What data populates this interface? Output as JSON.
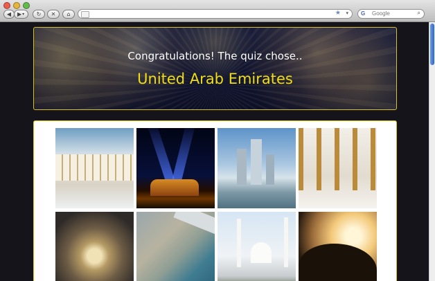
{
  "browser": {
    "url": "",
    "search_placeholder": "Google"
  },
  "banner": {
    "subtitle": "Congratulations! The quiz chose..",
    "title": "United Arab Emirates"
  },
  "gallery": {
    "photos": [
      {
        "name": "grand-mosque-courtyard"
      },
      {
        "name": "night-hotel-light-beams"
      },
      {
        "name": "city-skyline-waterfront"
      },
      {
        "name": "mosque-colonnade-gold-pillars"
      },
      {
        "name": "dome-interior-chandelier"
      },
      {
        "name": "aerial-island-coastline"
      },
      {
        "name": "white-mosque-minarets"
      },
      {
        "name": "desert-silhouettes-sunset"
      }
    ]
  },
  "colors": {
    "accent": "#f1de12",
    "banner_border": "#d9c21c",
    "page_background": "#14141a"
  }
}
